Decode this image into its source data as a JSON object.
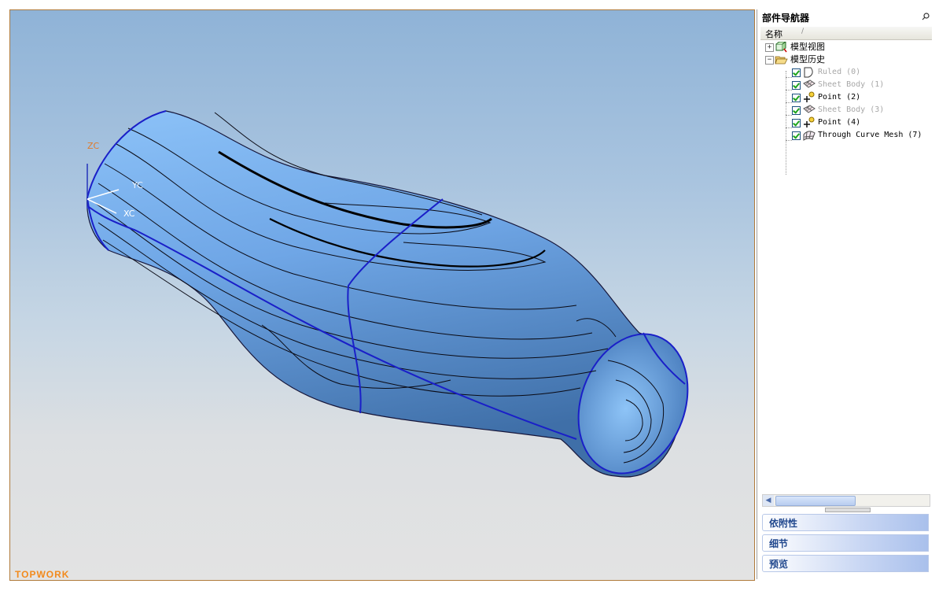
{
  "viewport": {
    "axis_labels": {
      "zc": "ZC",
      "yc": "YC",
      "xc": "XC"
    },
    "watermark": "TOPWORK"
  },
  "navigator": {
    "title": "部件导航器",
    "column_header": "名称",
    "column_sort_mark": "/",
    "tree": [
      {
        "label": "模型视图",
        "expander": "+",
        "icon": "model-views-icon",
        "dim": false
      },
      {
        "label": "模型历史",
        "expander": "−",
        "icon": "folder-open-icon",
        "dim": false
      },
      {
        "label": "Ruled (0)",
        "icon": "ruled-surface-icon",
        "dim": true
      },
      {
        "label": "Sheet Body (1)",
        "icon": "sheet-body-icon",
        "dim": true
      },
      {
        "label": "Point (2)",
        "icon": "point-icon",
        "dim": false
      },
      {
        "label": "Sheet Body (3)",
        "icon": "sheet-body-icon",
        "dim": true
      },
      {
        "label": "Point (4)",
        "icon": "point-icon",
        "dim": false
      },
      {
        "label": "Through Curve Mesh (7)",
        "icon": "curve-mesh-icon",
        "dim": false
      }
    ],
    "panels": [
      "依附性",
      "细节",
      "预览"
    ]
  },
  "colors": {
    "accent": "#21488e",
    "viewport_top": "#8fb3d7",
    "model": "#6fa6e6",
    "edge": "#1a1fc8"
  }
}
